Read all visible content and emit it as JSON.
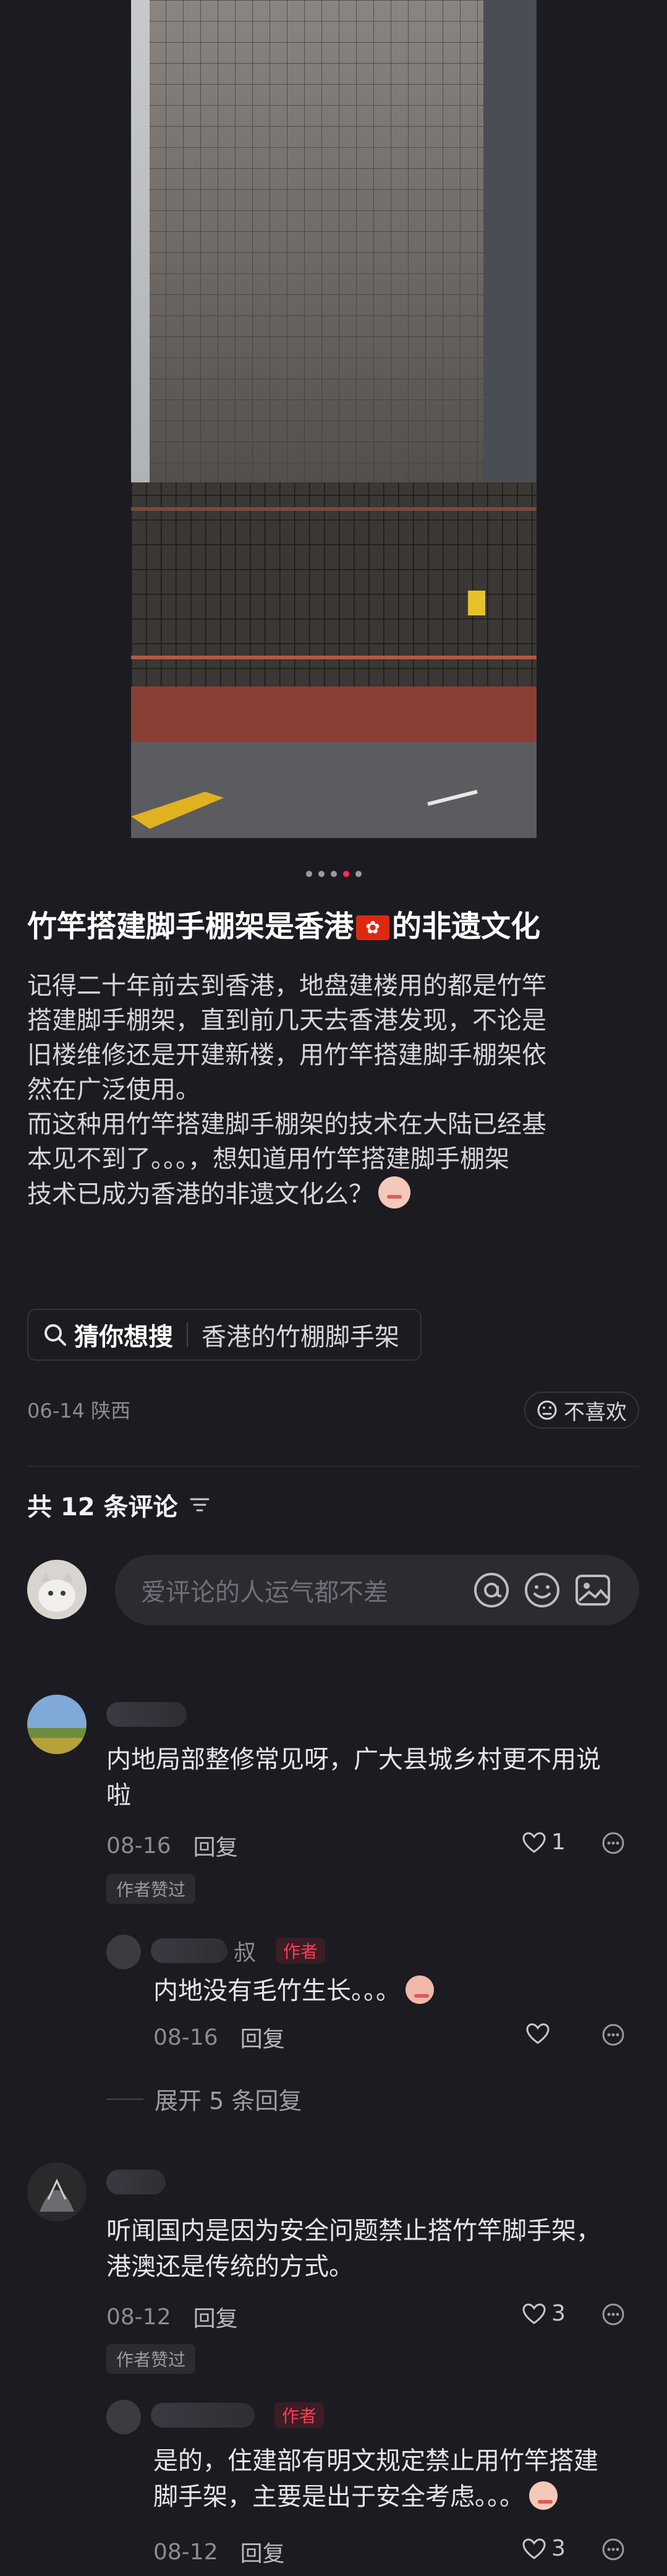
{
  "post": {
    "title_before_flag": "竹竿搭建脚手棚架是香港",
    "title_after_flag": "的非遗文化",
    "body_p1": "记得二十年前去到香港，地盘建楼用的都是竹竿\n搭建脚手棚架，直到前几天去香港发现，不论是\n旧楼维修还是开建新楼，用竹竿搭建脚手棚架依\n然在广泛使用。",
    "body_p2": "而这种用竹竿搭建脚手棚架的技术在大陆已经基\n本见不到了。。。，想知道用竹竿搭建脚手棚架\n技术已成为香港的非遗文化么？",
    "carousel": {
      "count": 5,
      "active_index": 3
    },
    "search": {
      "label": "猜你想搜",
      "query": "香港的竹棚脚手架"
    },
    "date": "06-14",
    "location": "陕西",
    "dislike_label": "不喜欢"
  },
  "comments_header": {
    "label": "共 12 条评论"
  },
  "comment_input": {
    "placeholder": "爱评论的人运气都不差"
  },
  "comments": [
    {
      "text": "内地局部整修常见呀，广大县城乡村更不用说\n啦",
      "date": "08-16",
      "reply_label": "回复",
      "likes": "1",
      "author_liked": "作者赞过",
      "reply": {
        "name_suffix": "叔",
        "author_tag": "作者",
        "text": "内地没有毛竹生长。。。",
        "date": "08-16",
        "reply_label": "回复"
      },
      "expand": "展开 5 条回复"
    },
    {
      "text": "听闻国内是因为安全问题禁止搭竹竿脚手架，\n港澳还是传统的方式。",
      "date": "08-12",
      "reply_label": "回复",
      "likes": "3",
      "author_liked": "作者赞过",
      "reply": {
        "author_tag": "作者",
        "text": "是的，住建部有明文规定禁止用竹竿搭建\n脚手架，主要是出于安全考虑。。。",
        "date": "08-12",
        "reply_label": "回复",
        "likes": "3"
      }
    }
  ],
  "colors": {
    "accent": "#ff2e4d",
    "background": "#1b1b21"
  }
}
